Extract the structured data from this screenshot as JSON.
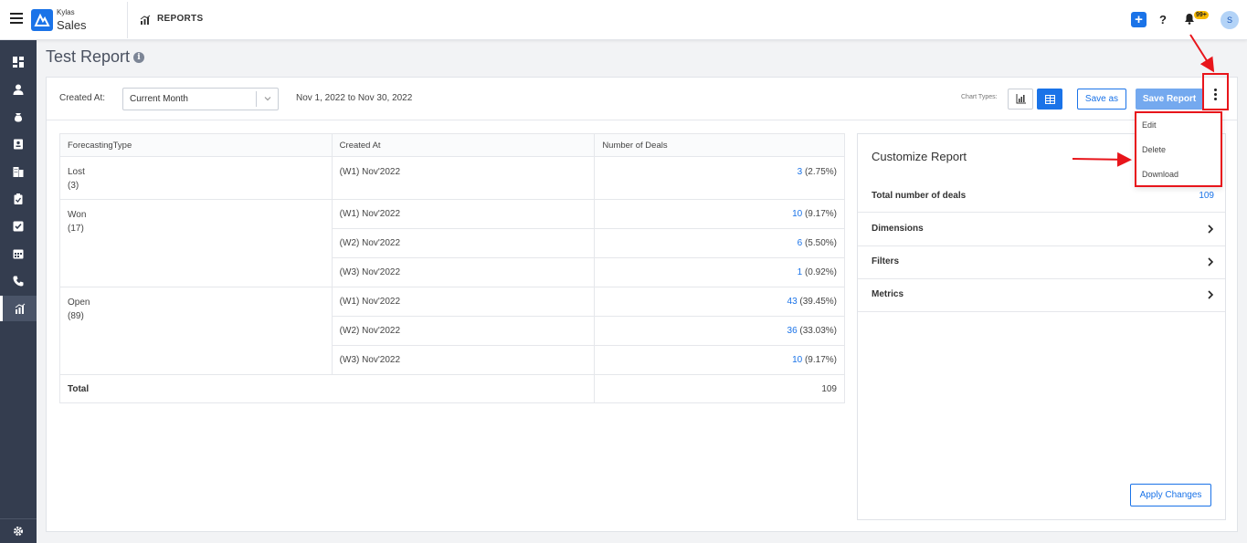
{
  "topbar": {
    "brand_small": "Kylas",
    "brand_large": "Sales",
    "section": "REPORTS",
    "notification_badge": "99+",
    "avatar_initial": "S"
  },
  "page": {
    "title": "Test Report"
  },
  "filter_bar": {
    "created_at_label": "Created At:",
    "created_at_value": "Current Month",
    "date_range": "Nov 1, 2022 to Nov 30, 2022",
    "chart_types_label": "Chart Types:",
    "save_as_label": "Save as",
    "save_report_label": "Save Report"
  },
  "table": {
    "headers": [
      "ForecastingType",
      "Created At",
      "Number of Deals"
    ],
    "groups": [
      {
        "name": "Lost",
        "count": "(3)",
        "rows": [
          {
            "week": "(W1) Nov'2022",
            "value": "3",
            "pct": " (2.75%)"
          }
        ]
      },
      {
        "name": "Won",
        "count": "(17)",
        "rows": [
          {
            "week": "(W1) Nov'2022",
            "value": "10",
            "pct": " (9.17%)"
          },
          {
            "week": "(W2) Nov'2022",
            "value": "6",
            "pct": " (5.50%)"
          },
          {
            "week": "(W3) Nov'2022",
            "value": "1",
            "pct": " (0.92%)"
          }
        ]
      },
      {
        "name": "Open",
        "count": "(89)",
        "rows": [
          {
            "week": "(W1) Nov'2022",
            "value": "43",
            "pct": " (39.45%)"
          },
          {
            "week": "(W2) Nov'2022",
            "value": "36",
            "pct": " (33.03%)"
          },
          {
            "week": "(W3) Nov'2022",
            "value": "10",
            "pct": " (9.17%)"
          }
        ]
      }
    ],
    "total_label": "Total",
    "total_value": "109"
  },
  "customize": {
    "title": "Customize Report",
    "total_label": "Total number of deals",
    "total_value": "109",
    "sections": [
      "Dimensions",
      "Filters",
      "Metrics"
    ],
    "apply_label": "Apply Changes"
  },
  "menu": {
    "items": [
      "Edit",
      "Delete",
      "Download"
    ]
  },
  "colors": {
    "accent": "#1a73e8",
    "sidebar": "#343d4f",
    "annotation": "#e8151b"
  }
}
